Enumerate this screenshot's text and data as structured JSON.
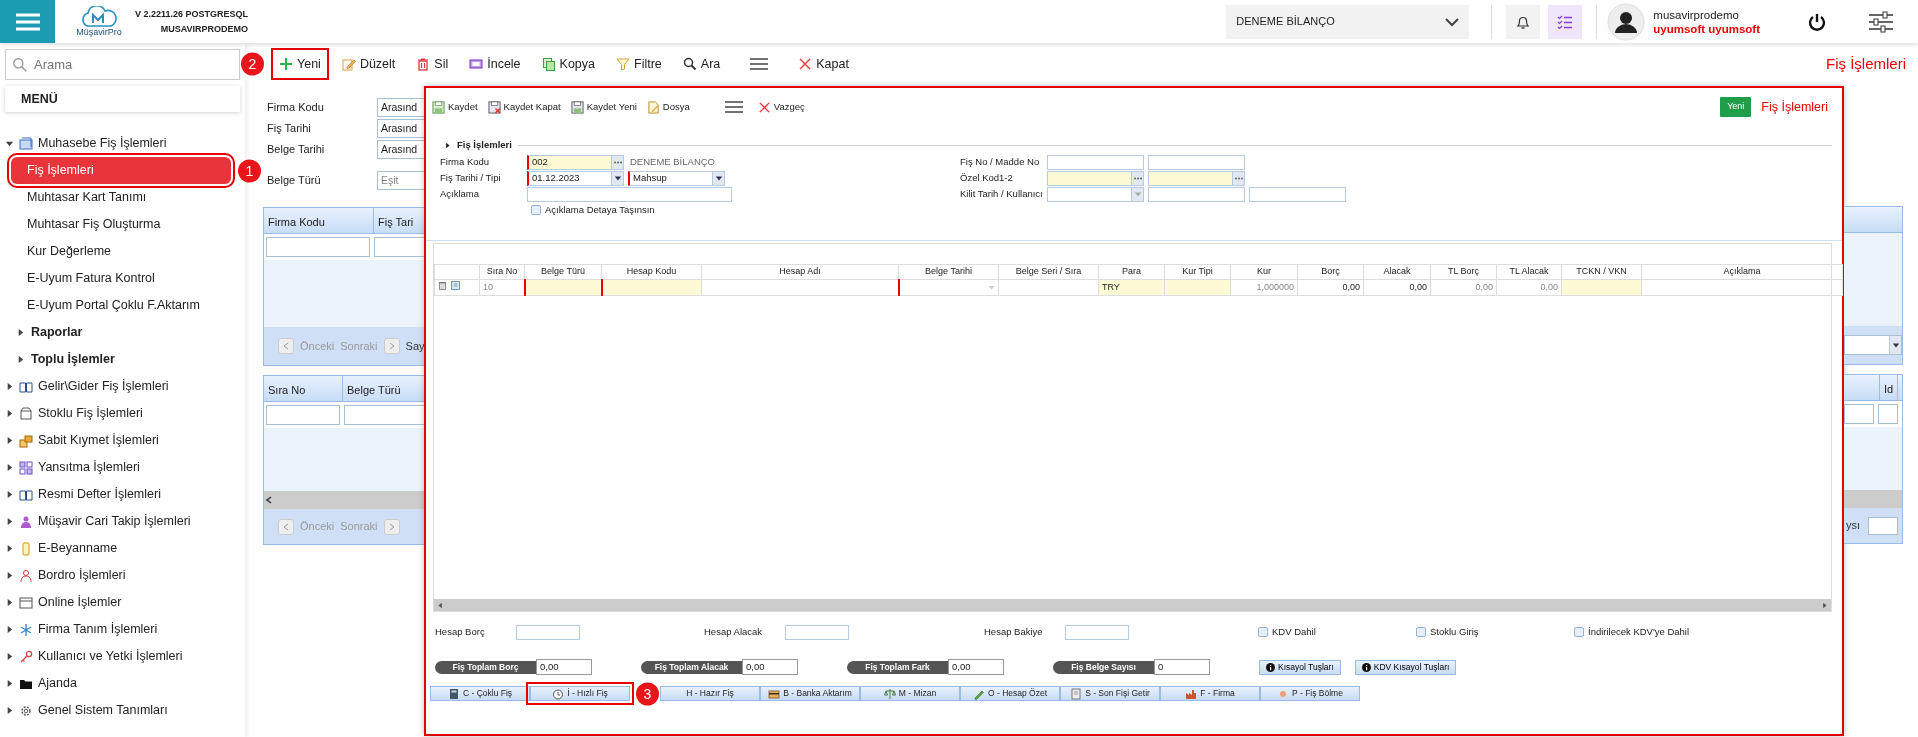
{
  "header": {
    "logo_text": "MüşavirPro",
    "version": "V 2.2211.26 POSTGRESQL",
    "account": "MUSAVIRPRODEMO",
    "company": "DENEME BİLANÇO",
    "user_name": "musavirprodemo",
    "user_company": "uyumsoft uyumsoft"
  },
  "sidebar": {
    "search_placeholder": "Arama",
    "menu_title": "MENÜ",
    "items": [
      {
        "label": "Muhasebe Fiş İşlemleri",
        "expanded": true,
        "children": [
          {
            "kind": "link",
            "label": "Fiş İşlemleri",
            "selected": true,
            "annotation": "1"
          },
          {
            "kind": "link",
            "label": "Muhtasar Kart Tanımı",
            "selected": false
          },
          {
            "kind": "link",
            "label": "Muhtasar Fiş Oluşturma",
            "selected": false
          },
          {
            "kind": "link",
            "label": "Kur Değerleme",
            "selected": false
          },
          {
            "kind": "link",
            "label": "E-Uyum Fatura Kontrol",
            "selected": false
          },
          {
            "kind": "link",
            "label": "E-Uyum Portal Çoklu F.Aktarım",
            "selected": false
          },
          {
            "kind": "group",
            "label": "Raporlar",
            "expanded": false
          },
          {
            "kind": "group",
            "label": "Toplu İşlemler",
            "expanded": false
          }
        ]
      },
      {
        "label": "Gelir\\Gider Fiş İşlemleri",
        "expanded": false
      },
      {
        "label": "Stoklu Fiş İşlemleri",
        "expanded": false
      },
      {
        "label": "Sabit Kıymet İşlemleri",
        "expanded": false
      },
      {
        "label": "Yansıtma İşlemleri",
        "expanded": false
      },
      {
        "label": "Resmi Defter İşlemleri",
        "expanded": false
      },
      {
        "label": "Müşavir Cari Takip İşlemleri",
        "expanded": false
      },
      {
        "label": "E-Beyanname",
        "expanded": false
      },
      {
        "label": "Bordro İşlemleri",
        "expanded": false
      },
      {
        "label": "Online İşlemler",
        "expanded": false
      },
      {
        "label": "Firma Tanım İşlemleri",
        "expanded": false
      },
      {
        "label": "Kullanıcı ve Yetki İşlemleri",
        "expanded": false
      },
      {
        "label": "Ajanda",
        "expanded": false
      },
      {
        "label": "Genel Sistem Tanımları",
        "expanded": false
      }
    ]
  },
  "toolbar": {
    "title": "Fiş İşlemleri",
    "items": [
      {
        "kind": "button",
        "label": "Yeni",
        "annotation": "2"
      },
      {
        "kind": "button",
        "label": "Düzelt"
      },
      {
        "kind": "button",
        "label": "Sil"
      },
      {
        "kind": "button",
        "label": "İncele"
      },
      {
        "kind": "button",
        "label": "Kopya"
      },
      {
        "kind": "button",
        "label": "Filtre"
      },
      {
        "kind": "button",
        "label": "Ara"
      },
      {
        "kind": "menu"
      },
      {
        "kind": "button",
        "label": "Kapat"
      }
    ]
  },
  "list_view": {
    "filters": [
      {
        "label": "Firma Kodu",
        "operator": "Arasınd"
      },
      {
        "label": "Fiş Tarihi",
        "operator": "Arasınd"
      },
      {
        "label": "Belge Tarihi",
        "operator": "Arasınd"
      },
      {
        "label": "Belge Türü",
        "operator": "Eşit"
      }
    ],
    "header_grid": {
      "columns": [
        "Firma Kodu",
        "Fiş Tari"
      ],
      "pager": {
        "previous": "Önceki",
        "next": "Sonraki",
        "info": "Say"
      }
    },
    "detail_grid": {
      "columns": [
        "Sıra No",
        "Belge Türü"
      ],
      "right_column": "Id",
      "pager": {
        "previous": "Önceki",
        "next": "Sonraki",
        "info": "ysı"
      }
    }
  },
  "dialog": {
    "outlined": true,
    "status": "Yeni",
    "title": "Fiş İşlemleri",
    "section_title": "Fiş İşlemleri",
    "toolbar": [
      {
        "kind": "button",
        "label": "Kaydet"
      },
      {
        "kind": "button",
        "label": "Kaydet Kapat"
      },
      {
        "kind": "button",
        "label": "Kaydet Yeni"
      },
      {
        "kind": "button",
        "label": "Dosya"
      },
      {
        "kind": "menu"
      },
      {
        "kind": "button",
        "label": "Vazgeç"
      }
    ],
    "left_fields": [
      {
        "label": "Firma Kodu",
        "note": "DENEME BİLANÇO",
        "inputs": [
          {
            "kind": "lookup",
            "value": "002",
            "required": true,
            "highlight": true
          }
        ]
      },
      {
        "label": "Fiş Tarihi / Tipi",
        "inputs": [
          {
            "kind": "select",
            "value": "01.12.2023",
            "required": true,
            "highlight": false
          },
          {
            "kind": "select",
            "value": "Mahsup",
            "required": true,
            "highlight": false
          }
        ]
      },
      {
        "label": "Açıklama",
        "inputs": [
          {
            "kind": "text",
            "required": false,
            "highlight": false
          }
        ]
      }
    ],
    "description_option": {
      "label": "Açıklama Detaya Taşınsın",
      "checked": false
    },
    "right_fields": [
      {
        "label": "Fiş No / Madde No",
        "inputs": [
          {
            "kind": "text",
            "required": false,
            "highlight": false
          },
          {
            "kind": "text",
            "required": false,
            "highlight": false
          }
        ]
      },
      {
        "label": "Özel Kod1-2",
        "inputs": [
          {
            "kind": "lookup",
            "required": false,
            "highlight": true
          },
          {
            "kind": "lookup",
            "required": false,
            "highlight": true
          }
        ]
      },
      {
        "label": "Kilit Tarih / Kullanıcı",
        "inputs": [
          {
            "kind": "select",
            "required": false,
            "highlight": false
          },
          {
            "kind": "text",
            "required": false,
            "highlight": false
          },
          {
            "kind": "text",
            "required": false,
            "highlight": false
          }
        ]
      }
    ],
    "grid": {
      "columns": [
        {
          "label": "Sıra No",
          "kind": "text",
          "required": false,
          "highlight": false
        },
        {
          "label": "Belge Türü",
          "kind": "text",
          "required": true,
          "highlight": true
        },
        {
          "label": "Hesap Kodu",
          "kind": "text",
          "required": true,
          "highlight": true
        },
        {
          "label": "Hesap Adı",
          "kind": "text",
          "required": false,
          "highlight": false
        },
        {
          "label": "Belge Tarihi",
          "kind": "select",
          "required": true,
          "highlight": false
        },
        {
          "label": "Belge Seri / Sıra",
          "kind": "text",
          "required": false,
          "highlight": false
        },
        {
          "label": "Para",
          "kind": "text",
          "required": false,
          "highlight": true
        },
        {
          "label": "Kur Tipi",
          "kind": "text",
          "required": false,
          "highlight": true
        },
        {
          "label": "Kur",
          "kind": "text",
          "required": false,
          "highlight": false
        },
        {
          "label": "Borç",
          "kind": "text",
          "required": false,
          "highlight": false
        },
        {
          "label": "Alacak",
          "kind": "text",
          "required": false,
          "highlight": false
        },
        {
          "label": "TL Borç",
          "kind": "text",
          "required": false,
          "highlight": false
        },
        {
          "label": "TL Alacak",
          "kind": "text",
          "required": false,
          "highlight": false
        },
        {
          "label": "TCKN / VKN",
          "kind": "text",
          "required": false,
          "highlight": true
        },
        {
          "label": "Açıklama",
          "kind": "text",
          "required": false,
          "highlight": false
        }
      ],
      "rows": [
        {
          "cells": [
            {
              "kind": "text",
              "value": "10",
              "muted": true
            },
            null,
            null,
            null,
            null,
            null,
            {
              "kind": "text",
              "value": "TRY",
              "muted": false
            },
            null,
            {
              "kind": "number",
              "value": "1,000000",
              "muted": true
            },
            {
              "kind": "number",
              "value": "0,00",
              "muted": false
            },
            {
              "kind": "number",
              "value": "0,00",
              "muted": false
            },
            {
              "kind": "number",
              "value": "0,00",
              "muted": true
            },
            {
              "kind": "number",
              "value": "0,00",
              "muted": true
            },
            null,
            null
          ]
        }
      ]
    },
    "account_fields": [
      {
        "label": "Hesap Borç"
      },
      {
        "label": "Hesap Alacak"
      },
      {
        "label": "Hesap Bakiye"
      }
    ],
    "options": [
      {
        "label": "KDV Dahil",
        "checked": false
      },
      {
        "label": "Stoklu Giriş",
        "checked": false
      },
      {
        "label": "İndirilecek KDV'ye Dahil",
        "checked": false
      }
    ],
    "totals": [
      {
        "label": "Fiş Toplam Borç",
        "value": "0,00"
      },
      {
        "label": "Fiş Toplam Alacak",
        "value": "0,00"
      },
      {
        "label": "Fiş Toplam Fark",
        "value": "0,00"
      },
      {
        "label": "Fiş Belge Sayısı",
        "value": "0"
      }
    ],
    "help_buttons": [
      {
        "label": "Kısayol Tuşları"
      },
      {
        "label": "KDV Kısayol Tuşları"
      }
    ],
    "shortcuts": [
      {
        "label": "C - Çoklu Fiş"
      },
      {
        "label": "İ - Hızlı Fiş",
        "annotation": "3"
      },
      {
        "label": "H - Hazır Fiş"
      },
      {
        "label": "B - Banka Aktarım"
      },
      {
        "label": "M - Mizan"
      },
      {
        "label": "O - Hesap Özet"
      },
      {
        "label": "S - Son Fişi Getir"
      },
      {
        "label": "F - Firma"
      },
      {
        "label": "P - Fiş Bölme"
      }
    ]
  }
}
